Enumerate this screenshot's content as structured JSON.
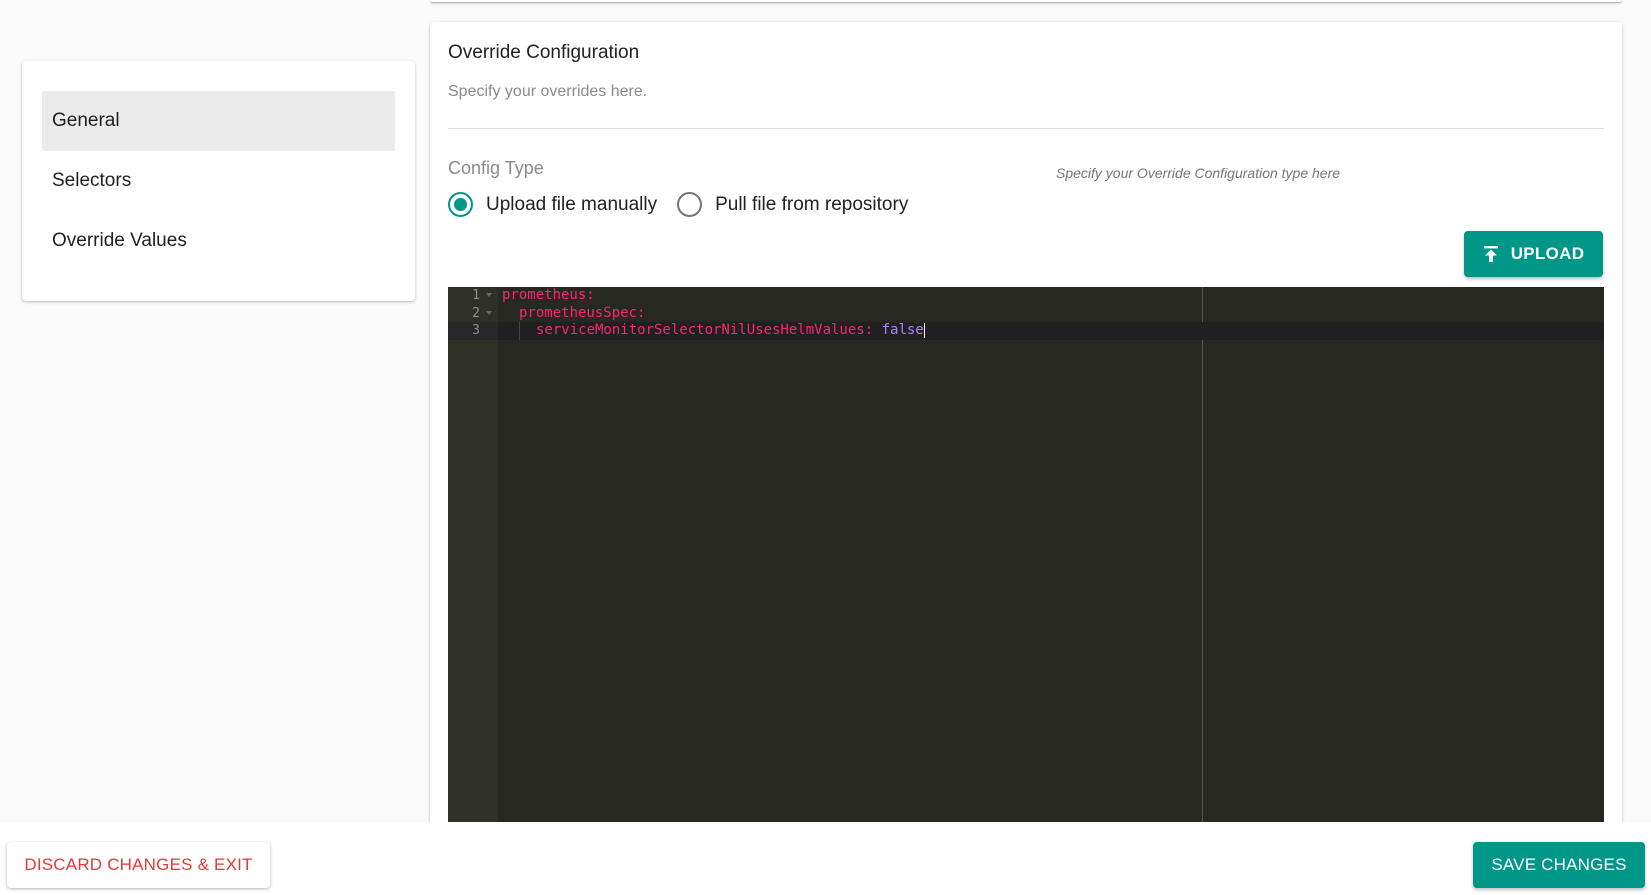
{
  "sidebar": {
    "items": [
      {
        "label": "General",
        "active": true
      },
      {
        "label": "Selectors",
        "active": false
      },
      {
        "label": "Override Values",
        "active": false
      }
    ]
  },
  "main": {
    "title": "Override Configuration",
    "subtitle": "Specify your overrides here.",
    "config_type": {
      "label": "Config Type",
      "hint": "Specify your Override Configuration type here",
      "options": [
        {
          "label": "Upload file manually",
          "selected": true
        },
        {
          "label": "Pull file from repository",
          "selected": false
        }
      ]
    },
    "upload_label": "UPLOAD",
    "editor": {
      "line_numbers": [
        "1",
        "2",
        "3"
      ],
      "line1_key": "prometheus:",
      "line2_key": "prometheusSpec:",
      "line3_key": "serviceMonitorSelectorNilUsesHelmValues:",
      "line3_value": "false"
    }
  },
  "footer": {
    "discard_label": "DISCARD CHANGES & EXIT",
    "save_label": "SAVE CHANGES"
  },
  "colors": {
    "accent": "#009688",
    "danger": "#e53935",
    "editor_bg": "#272822",
    "yaml_key": "#f92672",
    "yaml_bool": "#ae81ff"
  }
}
